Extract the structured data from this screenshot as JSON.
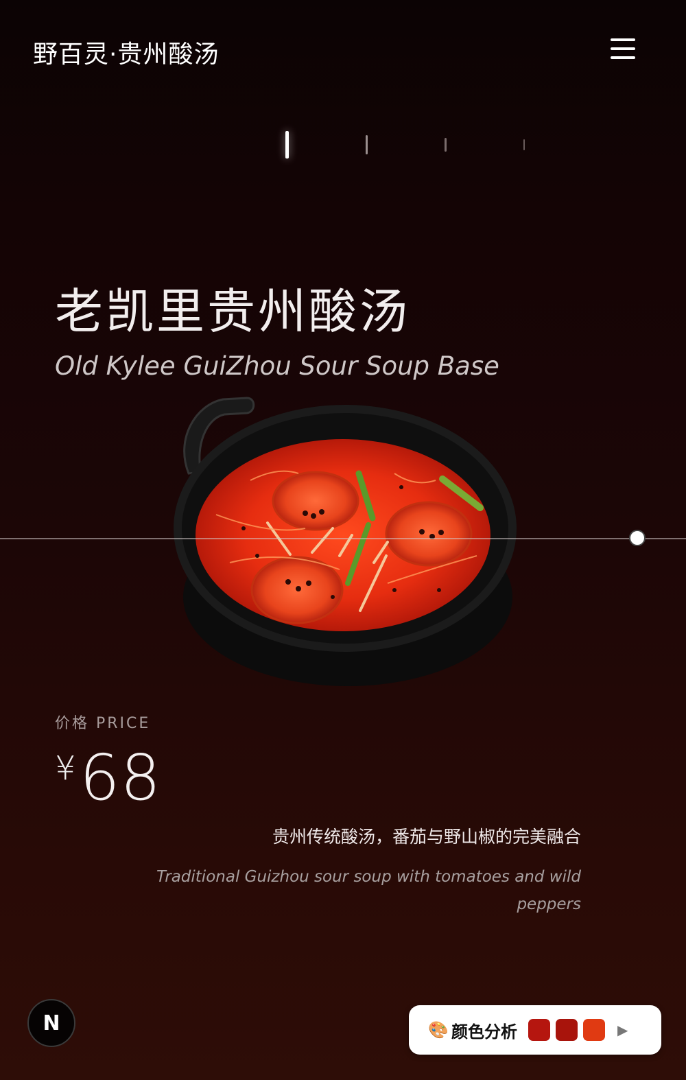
{
  "header": {
    "brand": "野百灵·贵州酸汤",
    "menu_icon": "hamburger-menu-icon"
  },
  "carousel": {
    "slides": 4,
    "active_index": 0
  },
  "dish": {
    "name_cn": "老凯里贵州酸汤",
    "name_en": "Old Kylee GuiZhou Sour Soup Base"
  },
  "price": {
    "label": "价格 PRICE",
    "currency": "¥",
    "amount": "68"
  },
  "description": {
    "cn": "贵州传统酸汤，番茄与野山椒的完美融合",
    "en": "Traditional Guizhou sour soup with tomatoes and wild peppers"
  },
  "badge": {
    "letter": "N"
  },
  "color_analysis": {
    "icon": "🎨",
    "label": "颜色分析",
    "swatches": [
      "#b5160f",
      "#a8140c",
      "#e03a12"
    ],
    "play_icon": "▶"
  }
}
